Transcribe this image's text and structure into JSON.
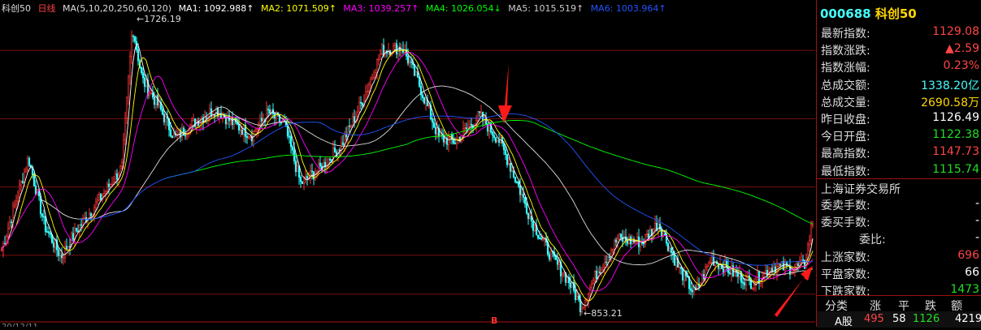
{
  "ma_bar": {
    "title": "科创50",
    "period": "日线",
    "ma_params": "MA(5,10,20,250,60,120)",
    "ma1": "MA1: 1092.988↑",
    "ma2": "MA2: 1071.509↑",
    "ma3": "MA3: 1039.257↑",
    "ma4": "MA4: 1026.054↓",
    "ma5": "MA5: 1015.519↑",
    "ma6": "MA6: 1003.964↑",
    "colors": {
      "ma1": "#ffffff",
      "ma2": "#ffff00",
      "ma3": "#ff00ff",
      "ma4": "#00ff00",
      "ma5": "#cccccc",
      "ma6": "#2255ff"
    }
  },
  "chart_data": {
    "type": "candlestick",
    "high_label": "1726.19",
    "low_label": "853.21",
    "bottom_marker": "B",
    "bottom_left_text": "20/12/11",
    "yrange": [
      820,
      1760
    ],
    "gridlines": [
      1650,
      1440,
      1230,
      1020,
      900
    ],
    "annotations": [
      "down-arrow near peak",
      "up-arrow at latest bars"
    ]
  },
  "panel": {
    "code": "000688",
    "name": "科创50",
    "rows": [
      {
        "label": "最新指数:",
        "value": "1129.08",
        "color": "red"
      },
      {
        "label": "指数涨跌:",
        "value": "▲2.59",
        "color": "red"
      },
      {
        "label": "指数涨幅:",
        "value": "0.23%",
        "color": "red"
      },
      {
        "label": "总成交额:",
        "value": "1338.20亿",
        "color": "cyan"
      },
      {
        "label": "总成交量:",
        "value": "2690.58万",
        "color": "yellow"
      },
      {
        "label": "昨日收盘:",
        "value": "1126.49",
        "color": "white"
      },
      {
        "label": "今日开盘:",
        "value": "1122.38",
        "color": "green"
      },
      {
        "label": "最高指数:",
        "value": "1147.73",
        "color": "red"
      },
      {
        "label": "最低指数:",
        "value": "1115.74",
        "color": "green"
      },
      {
        "label": "上海证券交易所",
        "value": "",
        "color": "white"
      },
      {
        "label": "委卖手数:",
        "value": "-",
        "color": "white"
      },
      {
        "label": "委买手数:",
        "value": "-",
        "color": "white"
      },
      {
        "label": "委比:",
        "value": "-",
        "color": "white"
      },
      {
        "label": "上涨家数:",
        "value": "696",
        "color": "red"
      },
      {
        "label": "平盘家数:",
        "value": "66",
        "color": "white"
      },
      {
        "label": "下跌家数:",
        "value": "1473",
        "color": "green"
      }
    ],
    "table_header": [
      "分类",
      "涨",
      "平",
      "跌",
      "额(亿)"
    ],
    "table_row": [
      "A股",
      "495",
      "58",
      "1126",
      "4219"
    ]
  }
}
